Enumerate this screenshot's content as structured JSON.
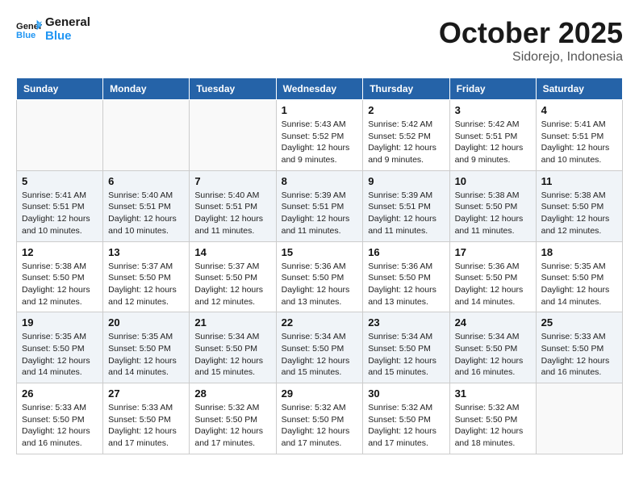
{
  "logo": {
    "line1": "General",
    "line2": "Blue"
  },
  "title": "October 2025",
  "location": "Sidorejo, Indonesia",
  "days_header": [
    "Sunday",
    "Monday",
    "Tuesday",
    "Wednesday",
    "Thursday",
    "Friday",
    "Saturday"
  ],
  "weeks": [
    [
      {
        "day": "",
        "info": ""
      },
      {
        "day": "",
        "info": ""
      },
      {
        "day": "",
        "info": ""
      },
      {
        "day": "1",
        "info": "Sunrise: 5:43 AM\nSunset: 5:52 PM\nDaylight: 12 hours\nand 9 minutes."
      },
      {
        "day": "2",
        "info": "Sunrise: 5:42 AM\nSunset: 5:52 PM\nDaylight: 12 hours\nand 9 minutes."
      },
      {
        "day": "3",
        "info": "Sunrise: 5:42 AM\nSunset: 5:51 PM\nDaylight: 12 hours\nand 9 minutes."
      },
      {
        "day": "4",
        "info": "Sunrise: 5:41 AM\nSunset: 5:51 PM\nDaylight: 12 hours\nand 10 minutes."
      }
    ],
    [
      {
        "day": "5",
        "info": "Sunrise: 5:41 AM\nSunset: 5:51 PM\nDaylight: 12 hours\nand 10 minutes."
      },
      {
        "day": "6",
        "info": "Sunrise: 5:40 AM\nSunset: 5:51 PM\nDaylight: 12 hours\nand 10 minutes."
      },
      {
        "day": "7",
        "info": "Sunrise: 5:40 AM\nSunset: 5:51 PM\nDaylight: 12 hours\nand 11 minutes."
      },
      {
        "day": "8",
        "info": "Sunrise: 5:39 AM\nSunset: 5:51 PM\nDaylight: 12 hours\nand 11 minutes."
      },
      {
        "day": "9",
        "info": "Sunrise: 5:39 AM\nSunset: 5:51 PM\nDaylight: 12 hours\nand 11 minutes."
      },
      {
        "day": "10",
        "info": "Sunrise: 5:38 AM\nSunset: 5:50 PM\nDaylight: 12 hours\nand 11 minutes."
      },
      {
        "day": "11",
        "info": "Sunrise: 5:38 AM\nSunset: 5:50 PM\nDaylight: 12 hours\nand 12 minutes."
      }
    ],
    [
      {
        "day": "12",
        "info": "Sunrise: 5:38 AM\nSunset: 5:50 PM\nDaylight: 12 hours\nand 12 minutes."
      },
      {
        "day": "13",
        "info": "Sunrise: 5:37 AM\nSunset: 5:50 PM\nDaylight: 12 hours\nand 12 minutes."
      },
      {
        "day": "14",
        "info": "Sunrise: 5:37 AM\nSunset: 5:50 PM\nDaylight: 12 hours\nand 12 minutes."
      },
      {
        "day": "15",
        "info": "Sunrise: 5:36 AM\nSunset: 5:50 PM\nDaylight: 12 hours\nand 13 minutes."
      },
      {
        "day": "16",
        "info": "Sunrise: 5:36 AM\nSunset: 5:50 PM\nDaylight: 12 hours\nand 13 minutes."
      },
      {
        "day": "17",
        "info": "Sunrise: 5:36 AM\nSunset: 5:50 PM\nDaylight: 12 hours\nand 14 minutes."
      },
      {
        "day": "18",
        "info": "Sunrise: 5:35 AM\nSunset: 5:50 PM\nDaylight: 12 hours\nand 14 minutes."
      }
    ],
    [
      {
        "day": "19",
        "info": "Sunrise: 5:35 AM\nSunset: 5:50 PM\nDaylight: 12 hours\nand 14 minutes."
      },
      {
        "day": "20",
        "info": "Sunrise: 5:35 AM\nSunset: 5:50 PM\nDaylight: 12 hours\nand 14 minutes."
      },
      {
        "day": "21",
        "info": "Sunrise: 5:34 AM\nSunset: 5:50 PM\nDaylight: 12 hours\nand 15 minutes."
      },
      {
        "day": "22",
        "info": "Sunrise: 5:34 AM\nSunset: 5:50 PM\nDaylight: 12 hours\nand 15 minutes."
      },
      {
        "day": "23",
        "info": "Sunrise: 5:34 AM\nSunset: 5:50 PM\nDaylight: 12 hours\nand 15 minutes."
      },
      {
        "day": "24",
        "info": "Sunrise: 5:34 AM\nSunset: 5:50 PM\nDaylight: 12 hours\nand 16 minutes."
      },
      {
        "day": "25",
        "info": "Sunrise: 5:33 AM\nSunset: 5:50 PM\nDaylight: 12 hours\nand 16 minutes."
      }
    ],
    [
      {
        "day": "26",
        "info": "Sunrise: 5:33 AM\nSunset: 5:50 PM\nDaylight: 12 hours\nand 16 minutes."
      },
      {
        "day": "27",
        "info": "Sunrise: 5:33 AM\nSunset: 5:50 PM\nDaylight: 12 hours\nand 17 minutes."
      },
      {
        "day": "28",
        "info": "Sunrise: 5:32 AM\nSunset: 5:50 PM\nDaylight: 12 hours\nand 17 minutes."
      },
      {
        "day": "29",
        "info": "Sunrise: 5:32 AM\nSunset: 5:50 PM\nDaylight: 12 hours\nand 17 minutes."
      },
      {
        "day": "30",
        "info": "Sunrise: 5:32 AM\nSunset: 5:50 PM\nDaylight: 12 hours\nand 17 minutes."
      },
      {
        "day": "31",
        "info": "Sunrise: 5:32 AM\nSunset: 5:50 PM\nDaylight: 12 hours\nand 18 minutes."
      },
      {
        "day": "",
        "info": ""
      }
    ]
  ]
}
